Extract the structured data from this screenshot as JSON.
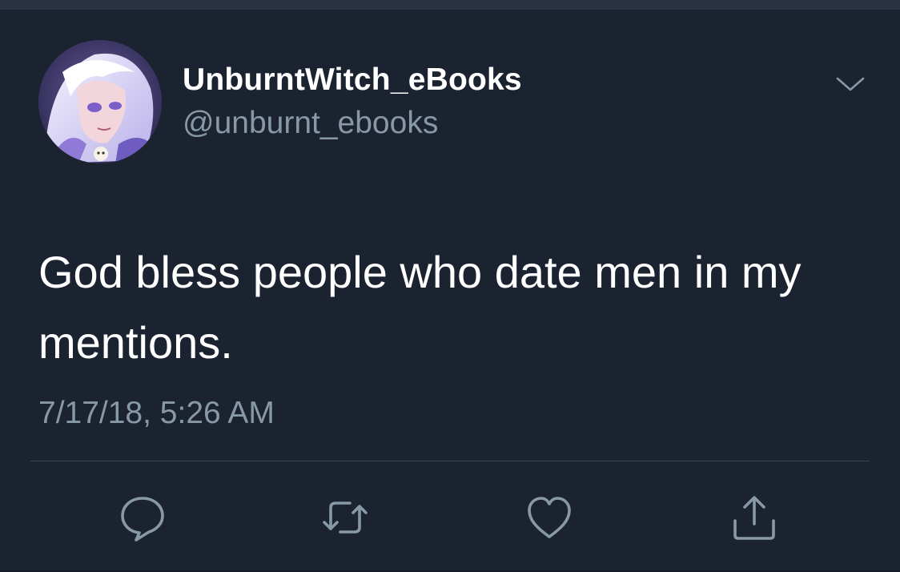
{
  "tweet": {
    "display_name": "UnburntWitch_eBooks",
    "handle": "@unburnt_ebooks",
    "text": "God bless people who date men in my mentions.",
    "timestamp": "7/17/18, 5:26 AM"
  },
  "icons": {
    "menu": "chevron-down-icon",
    "reply": "reply-icon",
    "retweet": "retweet-icon",
    "like": "heart-icon",
    "share": "share-icon"
  },
  "colors": {
    "background": "#1b2230",
    "primary_text": "#ffffff",
    "secondary_text": "#8899a6",
    "divider": "#3a4455"
  }
}
